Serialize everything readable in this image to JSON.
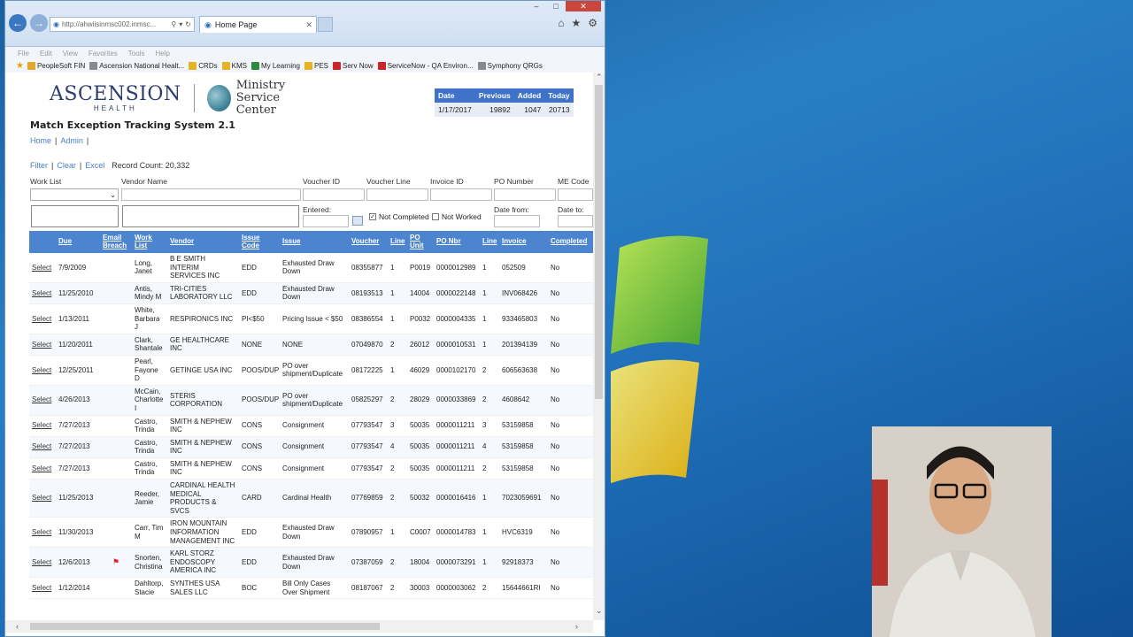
{
  "browser": {
    "address": "http://ahwiisinmsc002.inmsc...",
    "tab_title": "Home Page",
    "menu": [
      "File",
      "Edit",
      "View",
      "Favorites",
      "Tools",
      "Help"
    ],
    "favorites": [
      {
        "label": "PeopleSoft FIN",
        "color": "#e4a72a"
      },
      {
        "label": "Ascension National Healt...",
        "color": "#8a8a8a"
      },
      {
        "label": "CRDs",
        "color": "#e6b422"
      },
      {
        "label": "KMS",
        "color": "#e6b422"
      },
      {
        "label": "My Learning",
        "color": "#2c8a3a"
      },
      {
        "label": "PES",
        "color": "#e6b422"
      },
      {
        "label": "Serv Now",
        "color": "#c8262a"
      },
      {
        "label": "ServiceNow - QA Environ...",
        "color": "#c8262a"
      },
      {
        "label": "Symphony QRGs",
        "color": "#8a8a8a"
      }
    ]
  },
  "header": {
    "logo_main": "ASCENSION",
    "logo_sub": "HEALTH",
    "msc_line1": "Ministry",
    "msc_line2": "Service Center",
    "app_title": "Match Exception Tracking System 2.1"
  },
  "stats": {
    "headers": [
      "Date",
      "Previous",
      "Added",
      "Today"
    ],
    "values": [
      "1/17/2017",
      "19892",
      "1047",
      "20713"
    ]
  },
  "nav": {
    "home": "Home",
    "admin": "Admin",
    "sep": "|"
  },
  "filter_links": {
    "filter": "Filter",
    "clear": "Clear",
    "excel": "Excel",
    "record_count": "Record Count: 20,332"
  },
  "filters": {
    "work_list": "Work List",
    "vendor_name": "Vendor Name",
    "voucher_id": "Voucher ID",
    "voucher_line": "Voucher Line",
    "invoice_id": "Invoice ID",
    "po_number": "PO Number",
    "me_code": "ME Code",
    "entered": "Entered:",
    "not_completed": "Not Completed",
    "not_worked": "Not Worked",
    "date_from": "Date from:",
    "date_to": "Date to:"
  },
  "grid": {
    "columns": [
      "",
      "Due",
      "Email Breach",
      "Work List",
      "Vendor",
      "Issue Code",
      "Issue",
      "Voucher",
      "Line",
      "PO Unit",
      "PO Nbr",
      "Line",
      "Invoice",
      "Completed"
    ],
    "select_label": "Select",
    "rows": [
      [
        "7/9/2009",
        "",
        "Long, Janet",
        "B E SMITH INTERIM SERVICES INC",
        "EDD",
        "Exhausted Draw Down",
        "08355877",
        "1",
        "P0019",
        "0000012989",
        "1",
        "052509",
        "No"
      ],
      [
        "11/25/2010",
        "",
        "Antis, Mindy M",
        "TRI-CITIES LABORATORY LLC",
        "EDD",
        "Exhausted Draw Down",
        "08193513",
        "1",
        "14004",
        "0000022148",
        "1",
        "INV068426",
        "No"
      ],
      [
        "1/13/2011",
        "",
        "White, Barbara J",
        "RESPIRONICS INC",
        "PI<$50",
        "Pricing Issue < $50",
        "08386554",
        "1",
        "P0032",
        "0000004335",
        "1",
        "933465803",
        "No"
      ],
      [
        "11/20/2011",
        "",
        "Clark, Shantale",
        "GE HEALTHCARE INC",
        "NONE",
        "NONE",
        "07049870",
        "2",
        "26012",
        "0000010531",
        "1",
        "201394139",
        "No"
      ],
      [
        "12/25/2011",
        "",
        "Pearl, Fayone D",
        "GETINGE USA INC",
        "POOS/DUP",
        "PO over shipment/Duplicate",
        "08172225",
        "1",
        "46029",
        "0000102170",
        "2",
        "606563638",
        "No"
      ],
      [
        "4/26/2013",
        "",
        "McCain, Charlotte I",
        "STERIS CORPORATION",
        "POOS/DUP",
        "PO over shipment/Duplicate",
        "05825297",
        "2",
        "28029",
        "0000033869",
        "2",
        "4608642",
        "No"
      ],
      [
        "7/27/2013",
        "",
        "Castro, Trinda",
        "SMITH & NEPHEW INC",
        "CONS",
        "Consignment",
        "07793547",
        "3",
        "50035",
        "0000011211",
        "3",
        "53159858",
        "No"
      ],
      [
        "7/27/2013",
        "",
        "Castro, Trinda",
        "SMITH & NEPHEW INC",
        "CONS",
        "Consignment",
        "07793547",
        "4",
        "50035",
        "0000011211",
        "4",
        "53159858",
        "No"
      ],
      [
        "7/27/2013",
        "",
        "Castro, Trinda",
        "SMITH & NEPHEW INC",
        "CONS",
        "Consignment",
        "07793547",
        "2",
        "50035",
        "0000011211",
        "2",
        "53159858",
        "No"
      ],
      [
        "11/25/2013",
        "",
        "Reeder, Jamie",
        "CARDINAL HEALTH MEDICAL PRODUCTS & SVCS",
        "CARD",
        "Cardinal Health",
        "07769859",
        "2",
        "50032",
        "0000016416",
        "1",
        "7023059691",
        "No"
      ],
      [
        "11/30/2013",
        "",
        "Carr, Tim M",
        "IRON MOUNTAIN INFORMATION MANAGEMENT INC",
        "EDD",
        "Exhausted Draw Down",
        "07890957",
        "1",
        "C0007",
        "0000014783",
        "1",
        "HVC6319",
        "No"
      ],
      [
        "12/6/2013",
        "flag",
        "Snorten, Christina",
        "KARL STORZ ENDOSCOPY AMERICA INC",
        "EDD",
        "Exhausted Draw Down",
        "07387059",
        "2",
        "18004",
        "0000073291",
        "1",
        "92918373",
        "No"
      ],
      [
        "1/12/2014",
        "",
        "Dahltorp, Stacie",
        "SYNTHES USA SALES LLC",
        "BOC",
        "Bill Only Cases Over Shipment",
        "08187067",
        "2",
        "30003",
        "0000003062",
        "2",
        "15644661RI",
        "No"
      ]
    ]
  }
}
